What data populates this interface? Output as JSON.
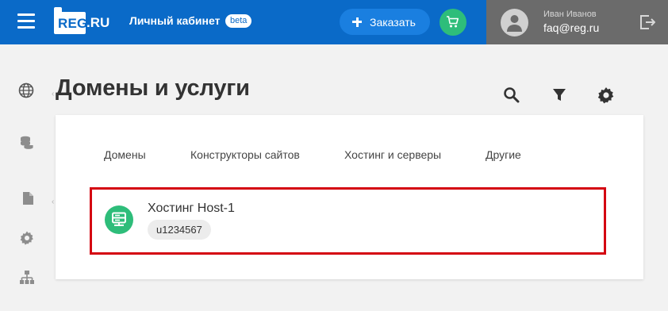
{
  "header": {
    "logo_reg": "REG",
    "logo_tail": ".RU",
    "cabinet_title": "Личный кабинет",
    "beta_badge": "beta",
    "order_label": "Заказать",
    "user_name": "Иван Иванов",
    "user_email": "faq@reg.ru"
  },
  "page": {
    "title": "Домены и услуги"
  },
  "tabs": [
    {
      "label": "Домены"
    },
    {
      "label": "Конструкторы сайтов"
    },
    {
      "label": "Хостинг и серверы"
    },
    {
      "label": "Другие"
    }
  ],
  "service": {
    "name": "Хостинг Host-1",
    "login": "u1234567"
  },
  "sidebar": {
    "icons": [
      "globe-icon",
      "database-icon",
      "document-icon",
      "gear-icon",
      "sitemap-icon"
    ],
    "collapse_marks": [
      "‹",
      "‹"
    ]
  },
  "colors": {
    "header_bg": "#0a6ac8",
    "order_btn": "#1a7fe0",
    "accent_green": "#2ebd7a",
    "user_panel": "#6b6b6b",
    "highlight_border": "#d40511",
    "page_bg": "#f2f2f2"
  }
}
